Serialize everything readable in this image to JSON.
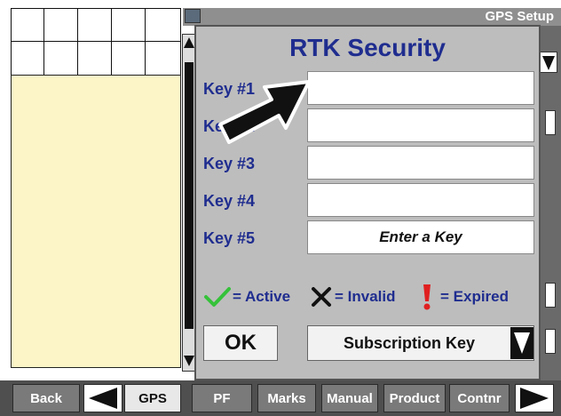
{
  "window": {
    "title": "GPS Setup"
  },
  "dialog": {
    "title": "RTK Security",
    "keys": [
      {
        "label": "Key #1",
        "value": ""
      },
      {
        "label": "Key #2",
        "value": ""
      },
      {
        "label": "Key #3",
        "value": ""
      },
      {
        "label": "Key #4",
        "value": ""
      },
      {
        "label": "Key #5",
        "value": "Enter a Key"
      }
    ],
    "legend": {
      "active": "= Active",
      "invalid": "= Invalid",
      "expired": "= Expired"
    },
    "ok_label": "OK",
    "subscription_label": "Subscription Key"
  },
  "colors": {
    "label_blue": "#1f2d8f",
    "active_green": "#35c23a",
    "expired_red": "#e02020"
  },
  "icons": [
    "pointer-arrow-icon",
    "check-icon",
    "x-icon",
    "exclamation-icon",
    "dropdown-arrow-icon",
    "left-arrow-icon",
    "right-arrow-icon"
  ],
  "bottom_tabs": {
    "back": "Back",
    "gps": "GPS",
    "pf": "PF",
    "marks": "Marks",
    "manual": "Manual",
    "product": "Product",
    "contnr": "Contnr"
  }
}
